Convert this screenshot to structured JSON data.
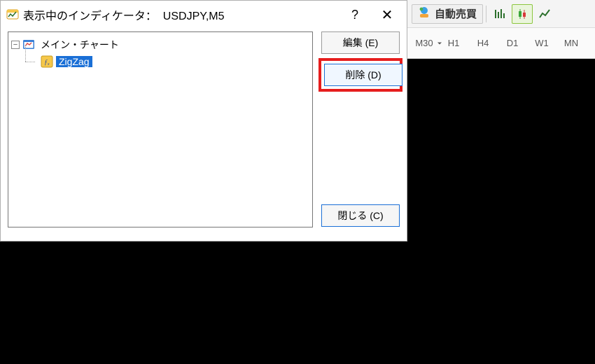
{
  "dialog": {
    "title_prefix": "表示中のインディケータ：",
    "title_symbol": "USDJPY,M5",
    "help_char": "?",
    "close_char": "✕"
  },
  "tree": {
    "root_label": "メイン・チャート",
    "child_label": "ZigZag"
  },
  "buttons": {
    "edit": "編集 (E)",
    "delete": "削除 (D)",
    "close": "閉じる (C)"
  },
  "toolbar": {
    "auto_trade": "自動売買"
  },
  "timeframes": [
    "M30",
    "H1",
    "H4",
    "D1",
    "W1",
    "MN"
  ]
}
